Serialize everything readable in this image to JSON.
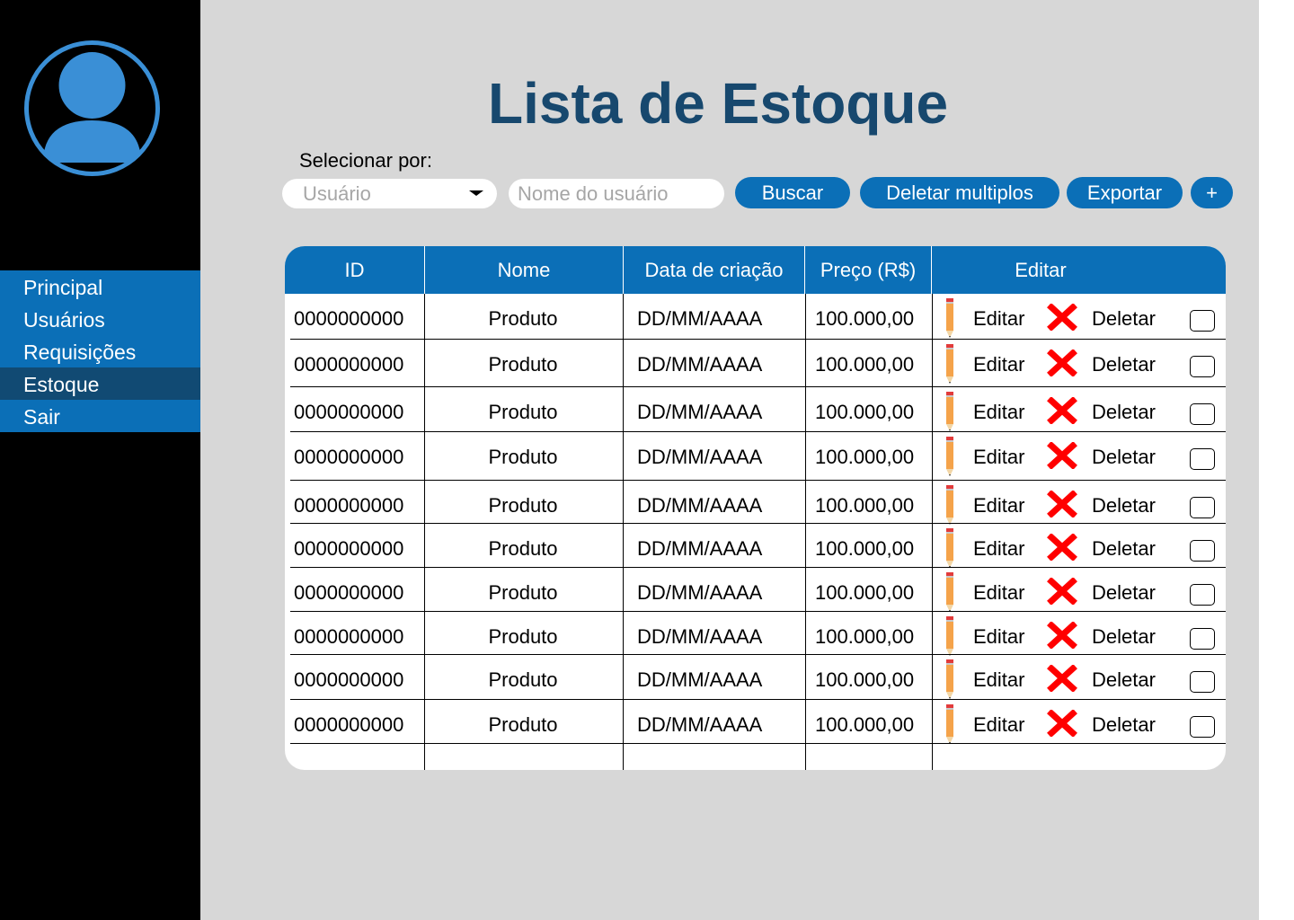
{
  "sidebar": {
    "avatar_icon": "user-avatar-icon",
    "items": [
      {
        "label": "Principal",
        "active": false
      },
      {
        "label": "Usuários",
        "active": false
      },
      {
        "label": "Requisições",
        "active": false
      },
      {
        "label": "Estoque",
        "active": true
      },
      {
        "label": "Sair",
        "active": false
      }
    ]
  },
  "header": {
    "title": "Lista de Estoque"
  },
  "filters": {
    "label": "Selecionar por:",
    "select_value": "Usuário",
    "search_placeholder": "Nome do usuário",
    "search_label": "Buscar",
    "delete_multiple_label": "Deletar multiplos",
    "export_label": "Exportar",
    "add_label": "+"
  },
  "table": {
    "columns": [
      "ID",
      "Nome",
      "Data de criação",
      "Preço (R$)",
      "Editar"
    ],
    "rows": [
      {
        "id": "0000000000",
        "name": "Produto",
        "date": "DD/MM/AAAA",
        "price": "100.000,00",
        "edit": "Editar",
        "delete": "Deletar"
      },
      {
        "id": "0000000000",
        "name": "Produto",
        "date": "DD/MM/AAAA",
        "price": "100.000,00",
        "edit": "Editar",
        "delete": "Deletar"
      },
      {
        "id": "0000000000",
        "name": "Produto",
        "date": "DD/MM/AAAA",
        "price": "100.000,00",
        "edit": "Editar",
        "delete": "Deletar"
      },
      {
        "id": "0000000000",
        "name": "Produto",
        "date": "DD/MM/AAAA",
        "price": "100.000,00",
        "edit": "Editar",
        "delete": "Deletar"
      },
      {
        "id": "0000000000",
        "name": "Produto",
        "date": "DD/MM/AAAA",
        "price": "100.000,00",
        "edit": "Editar",
        "delete": "Deletar"
      },
      {
        "id": "0000000000",
        "name": "Produto",
        "date": "DD/MM/AAAA",
        "price": "100.000,00",
        "edit": "Editar",
        "delete": "Deletar"
      },
      {
        "id": "0000000000",
        "name": "Produto",
        "date": "DD/MM/AAAA",
        "price": "100.000,00",
        "edit": "Editar",
        "delete": "Deletar"
      },
      {
        "id": "0000000000",
        "name": "Produto",
        "date": "DD/MM/AAAA",
        "price": "100.000,00",
        "edit": "Editar",
        "delete": "Deletar"
      },
      {
        "id": "0000000000",
        "name": "Produto",
        "date": "DD/MM/AAAA",
        "price": "100.000,00",
        "edit": "Editar",
        "delete": "Deletar"
      },
      {
        "id": "0000000000",
        "name": "Produto",
        "date": "DD/MM/AAAA",
        "price": "100.000,00",
        "edit": "Editar",
        "delete": "Deletar"
      }
    ]
  },
  "colors": {
    "sidebar_bg": "#000000",
    "nav_bg": "#0b6fb7",
    "nav_active_bg": "#114a73",
    "main_bg": "#d7d7d7",
    "title_color": "#17486e",
    "accent": "#0b6fb7",
    "avatar_blue": "#3a8fd6",
    "delete_red": "#ff0000",
    "pencil_orange": "#f5a34a"
  },
  "icons": {
    "edit": "pencil-icon",
    "delete": "red-x-icon",
    "select": "chevron-down-icon"
  }
}
